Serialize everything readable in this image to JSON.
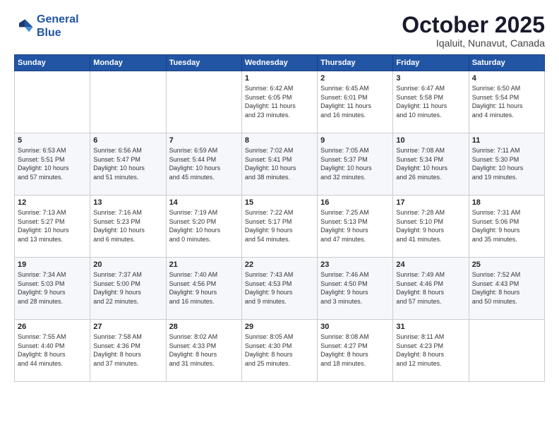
{
  "logo": {
    "line1": "General",
    "line2": "Blue"
  },
  "title": "October 2025",
  "subtitle": "Iqaluit, Nunavut, Canada",
  "days_of_week": [
    "Sunday",
    "Monday",
    "Tuesday",
    "Wednesday",
    "Thursday",
    "Friday",
    "Saturday"
  ],
  "weeks": [
    [
      {
        "day": "",
        "info": ""
      },
      {
        "day": "",
        "info": ""
      },
      {
        "day": "",
        "info": ""
      },
      {
        "day": "1",
        "info": "Sunrise: 6:42 AM\nSunset: 6:05 PM\nDaylight: 11 hours\nand 23 minutes."
      },
      {
        "day": "2",
        "info": "Sunrise: 6:45 AM\nSunset: 6:01 PM\nDaylight: 11 hours\nand 16 minutes."
      },
      {
        "day": "3",
        "info": "Sunrise: 6:47 AM\nSunset: 5:58 PM\nDaylight: 11 hours\nand 10 minutes."
      },
      {
        "day": "4",
        "info": "Sunrise: 6:50 AM\nSunset: 5:54 PM\nDaylight: 11 hours\nand 4 minutes."
      }
    ],
    [
      {
        "day": "5",
        "info": "Sunrise: 6:53 AM\nSunset: 5:51 PM\nDaylight: 10 hours\nand 57 minutes."
      },
      {
        "day": "6",
        "info": "Sunrise: 6:56 AM\nSunset: 5:47 PM\nDaylight: 10 hours\nand 51 minutes."
      },
      {
        "day": "7",
        "info": "Sunrise: 6:59 AM\nSunset: 5:44 PM\nDaylight: 10 hours\nand 45 minutes."
      },
      {
        "day": "8",
        "info": "Sunrise: 7:02 AM\nSunset: 5:41 PM\nDaylight: 10 hours\nand 38 minutes."
      },
      {
        "day": "9",
        "info": "Sunrise: 7:05 AM\nSunset: 5:37 PM\nDaylight: 10 hours\nand 32 minutes."
      },
      {
        "day": "10",
        "info": "Sunrise: 7:08 AM\nSunset: 5:34 PM\nDaylight: 10 hours\nand 26 minutes."
      },
      {
        "day": "11",
        "info": "Sunrise: 7:11 AM\nSunset: 5:30 PM\nDaylight: 10 hours\nand 19 minutes."
      }
    ],
    [
      {
        "day": "12",
        "info": "Sunrise: 7:13 AM\nSunset: 5:27 PM\nDaylight: 10 hours\nand 13 minutes."
      },
      {
        "day": "13",
        "info": "Sunrise: 7:16 AM\nSunset: 5:23 PM\nDaylight: 10 hours\nand 6 minutes."
      },
      {
        "day": "14",
        "info": "Sunrise: 7:19 AM\nSunset: 5:20 PM\nDaylight: 10 hours\nand 0 minutes."
      },
      {
        "day": "15",
        "info": "Sunrise: 7:22 AM\nSunset: 5:17 PM\nDaylight: 9 hours\nand 54 minutes."
      },
      {
        "day": "16",
        "info": "Sunrise: 7:25 AM\nSunset: 5:13 PM\nDaylight: 9 hours\nand 47 minutes."
      },
      {
        "day": "17",
        "info": "Sunrise: 7:28 AM\nSunset: 5:10 PM\nDaylight: 9 hours\nand 41 minutes."
      },
      {
        "day": "18",
        "info": "Sunrise: 7:31 AM\nSunset: 5:06 PM\nDaylight: 9 hours\nand 35 minutes."
      }
    ],
    [
      {
        "day": "19",
        "info": "Sunrise: 7:34 AM\nSunset: 5:03 PM\nDaylight: 9 hours\nand 28 minutes."
      },
      {
        "day": "20",
        "info": "Sunrise: 7:37 AM\nSunset: 5:00 PM\nDaylight: 9 hours\nand 22 minutes."
      },
      {
        "day": "21",
        "info": "Sunrise: 7:40 AM\nSunset: 4:56 PM\nDaylight: 9 hours\nand 16 minutes."
      },
      {
        "day": "22",
        "info": "Sunrise: 7:43 AM\nSunset: 4:53 PM\nDaylight: 9 hours\nand 9 minutes."
      },
      {
        "day": "23",
        "info": "Sunrise: 7:46 AM\nSunset: 4:50 PM\nDaylight: 9 hours\nand 3 minutes."
      },
      {
        "day": "24",
        "info": "Sunrise: 7:49 AM\nSunset: 4:46 PM\nDaylight: 8 hours\nand 57 minutes."
      },
      {
        "day": "25",
        "info": "Sunrise: 7:52 AM\nSunset: 4:43 PM\nDaylight: 8 hours\nand 50 minutes."
      }
    ],
    [
      {
        "day": "26",
        "info": "Sunrise: 7:55 AM\nSunset: 4:40 PM\nDaylight: 8 hours\nand 44 minutes."
      },
      {
        "day": "27",
        "info": "Sunrise: 7:58 AM\nSunset: 4:36 PM\nDaylight: 8 hours\nand 37 minutes."
      },
      {
        "day": "28",
        "info": "Sunrise: 8:02 AM\nSunset: 4:33 PM\nDaylight: 8 hours\nand 31 minutes."
      },
      {
        "day": "29",
        "info": "Sunrise: 8:05 AM\nSunset: 4:30 PM\nDaylight: 8 hours\nand 25 minutes."
      },
      {
        "day": "30",
        "info": "Sunrise: 8:08 AM\nSunset: 4:27 PM\nDaylight: 8 hours\nand 18 minutes."
      },
      {
        "day": "31",
        "info": "Sunrise: 8:11 AM\nSunset: 4:23 PM\nDaylight: 8 hours\nand 12 minutes."
      },
      {
        "day": "",
        "info": ""
      }
    ]
  ],
  "colors": {
    "header_bg": "#2255a4",
    "header_text": "#ffffff",
    "title_color": "#1a1a2e",
    "even_row": "#f5f7fa",
    "odd_row": "#ffffff"
  }
}
